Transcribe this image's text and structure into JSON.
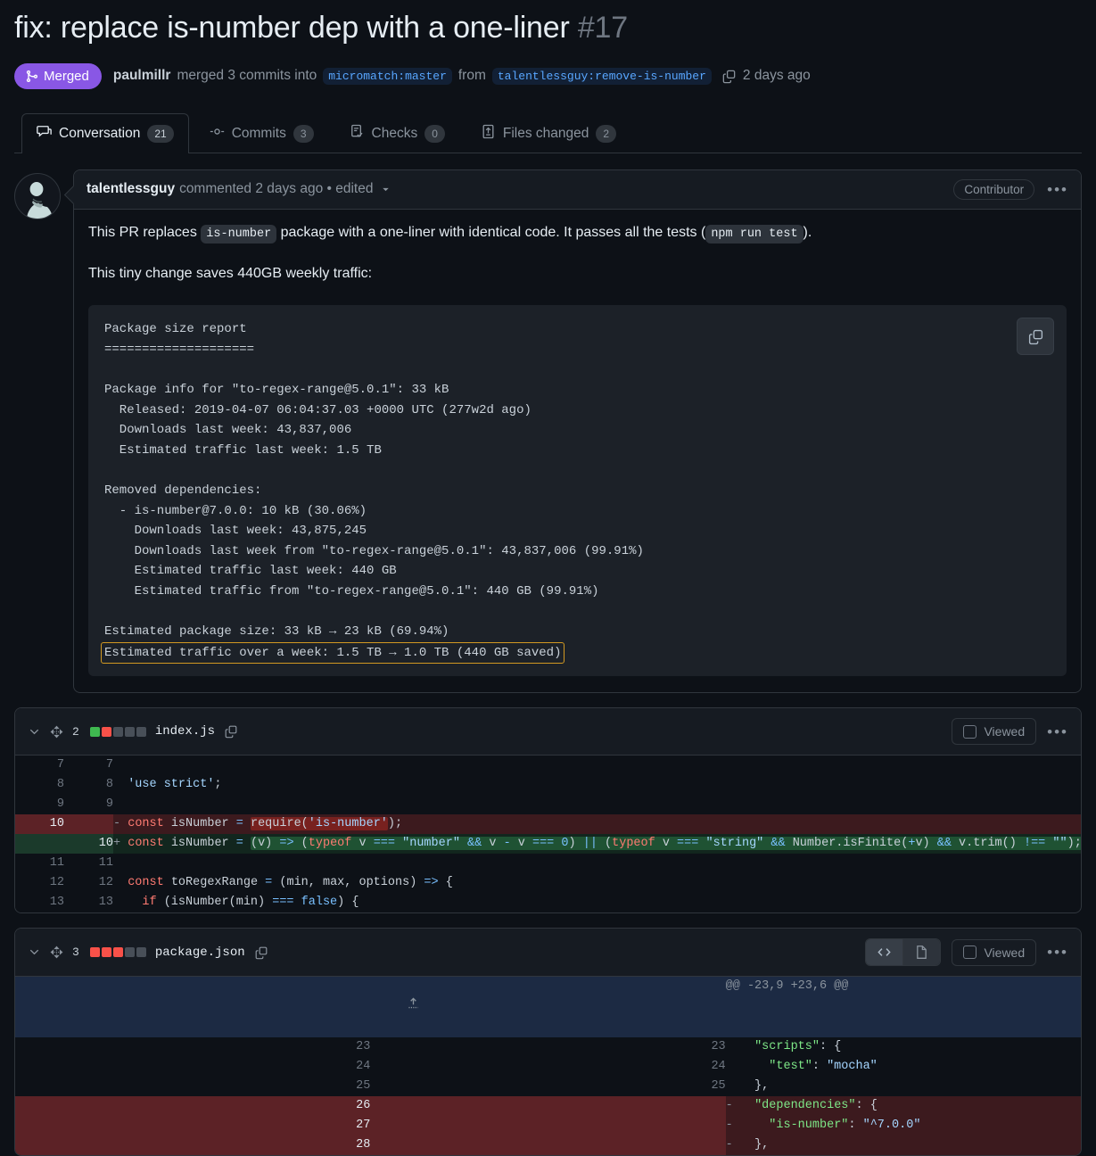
{
  "header": {
    "title": "fix: replace is-number dep with a one-liner",
    "number": "#17",
    "state": "Merged",
    "merger": "paulmillr",
    "merged_text": "merged 3 commits into",
    "base_branch": "micromatch:master",
    "from_text": "from",
    "head_branch": "talentlessguy:remove-is-number",
    "when": "2 days ago",
    "copy_branch_icon": "copy-icon"
  },
  "tabs": [
    {
      "label": "Conversation",
      "count": "21",
      "icon": "comment-icon",
      "active": true
    },
    {
      "label": "Commits",
      "count": "3",
      "icon": "commit-icon",
      "active": false
    },
    {
      "label": "Checks",
      "count": "0",
      "icon": "checklist-icon",
      "active": false
    },
    {
      "label": "Files changed",
      "count": "2",
      "icon": "file-diff-icon",
      "active": false
    }
  ],
  "comment": {
    "author": "talentlessguy",
    "meta": "commented 2 days ago • edited",
    "role_badge": "Contributor",
    "kebab": "•••",
    "paragraph1_a": "This PR replaces ",
    "paragraph1_code1": "is-number",
    "paragraph1_b": " package with a one-liner with identical code. It passes all the tests (",
    "paragraph1_code2": "npm run test",
    "paragraph1_c": ").",
    "paragraph2": "This tiny change saves 440GB weekly traffic:",
    "code_report": {
      "lines_before": "Package size report\n====================\n\nPackage info for \"to-regex-range@5.0.1\": 33 kB\n  Released: 2019-04-07 06:04:37.03 +0000 UTC (277w2d ago)\n  Downloads last week: 43,837,006\n  Estimated traffic last week: 1.5 TB\n\nRemoved dependencies:\n  - is-number@7.0.0: 10 kB (30.06%)\n    Downloads last week: 43,875,245\n    Downloads last week from \"to-regex-range@5.0.1\": 43,837,006 (99.91%)\n    Estimated traffic last week: 440 GB\n    Estimated traffic from \"to-regex-range@5.0.1\": 440 GB (99.91%)\n\nEstimated package size: 33 kB → 23 kB (69.94%)\n",
      "highlighted_line": "Estimated traffic over a week: 1.5 TB → 1.0 TB (440 GB saved)",
      "copy_button_icon": "copy-icon"
    }
  },
  "files": [
    {
      "name": "index.js",
      "changes_count": "2",
      "diffstat": [
        "add",
        "del",
        "neutral",
        "neutral",
        "neutral"
      ],
      "collapse_icon": "chevron-down-icon",
      "move_icon": "unfold-icon",
      "copy_path_icon": "copy-icon",
      "viewed_label": "Viewed",
      "kebab": "•••",
      "has_view_toggle": false,
      "rows": [
        {
          "type": "ctx",
          "old": "7",
          "new": "7",
          "marker": "",
          "code": ""
        },
        {
          "type": "ctx",
          "old": "8",
          "new": "8",
          "marker": "",
          "code": "'use strict';"
        },
        {
          "type": "ctx",
          "old": "9",
          "new": "9",
          "marker": "",
          "code": ""
        },
        {
          "type": "del",
          "old": "10",
          "new": "",
          "marker": "-",
          "code": "const isNumber = require('is-number');"
        },
        {
          "type": "add",
          "old": "",
          "new": "10",
          "marker": "+",
          "code": "const isNumber = (v) => (typeof v === \"number\" && v - v === 0) || (typeof v === \"string\" && Number.isFinite(+v) && v.trim() !== \"\");"
        },
        {
          "type": "ctx",
          "old": "11",
          "new": "11",
          "marker": "",
          "code": ""
        },
        {
          "type": "ctx",
          "old": "12",
          "new": "12",
          "marker": "",
          "code": "const toRegexRange = (min, max, options) => {"
        },
        {
          "type": "ctx",
          "old": "13",
          "new": "13",
          "marker": "",
          "code": "  if (isNumber(min) === false) {"
        }
      ]
    },
    {
      "name": "package.json",
      "changes_count": "3",
      "diffstat": [
        "del",
        "del",
        "del",
        "neutral",
        "neutral"
      ],
      "collapse_icon": "chevron-down-icon",
      "move_icon": "unfold-icon",
      "copy_path_icon": "copy-icon",
      "viewed_label": "Viewed",
      "kebab": "•••",
      "has_view_toggle": true,
      "view_code_icon": "code-icon",
      "view_rich_icon": "file-icon",
      "hunk_header": "@@ -23,9 +23,6 @@",
      "expander_icon": "expand-up-icon",
      "rows": [
        {
          "type": "ctx",
          "old": "23",
          "new": "23",
          "marker": "",
          "code": "  \"scripts\": {"
        },
        {
          "type": "ctx",
          "old": "24",
          "new": "24",
          "marker": "",
          "code": "    \"test\": \"mocha\""
        },
        {
          "type": "ctx",
          "old": "25",
          "new": "25",
          "marker": "",
          "code": "  },"
        },
        {
          "type": "del",
          "old": "26",
          "new": "",
          "marker": "-",
          "code": "  \"dependencies\": {"
        },
        {
          "type": "del",
          "old": "27",
          "new": "",
          "marker": "-",
          "code": "    \"is-number\": \"^7.0.0\""
        },
        {
          "type": "del",
          "old": "28",
          "new": "",
          "marker": "-",
          "code": "  },"
        }
      ]
    }
  ],
  "colors": {
    "merged": "#8957e5",
    "link": "#58a6ff",
    "highlight_border": "#d29922",
    "add": "#3fb950",
    "del": "#f85149"
  }
}
